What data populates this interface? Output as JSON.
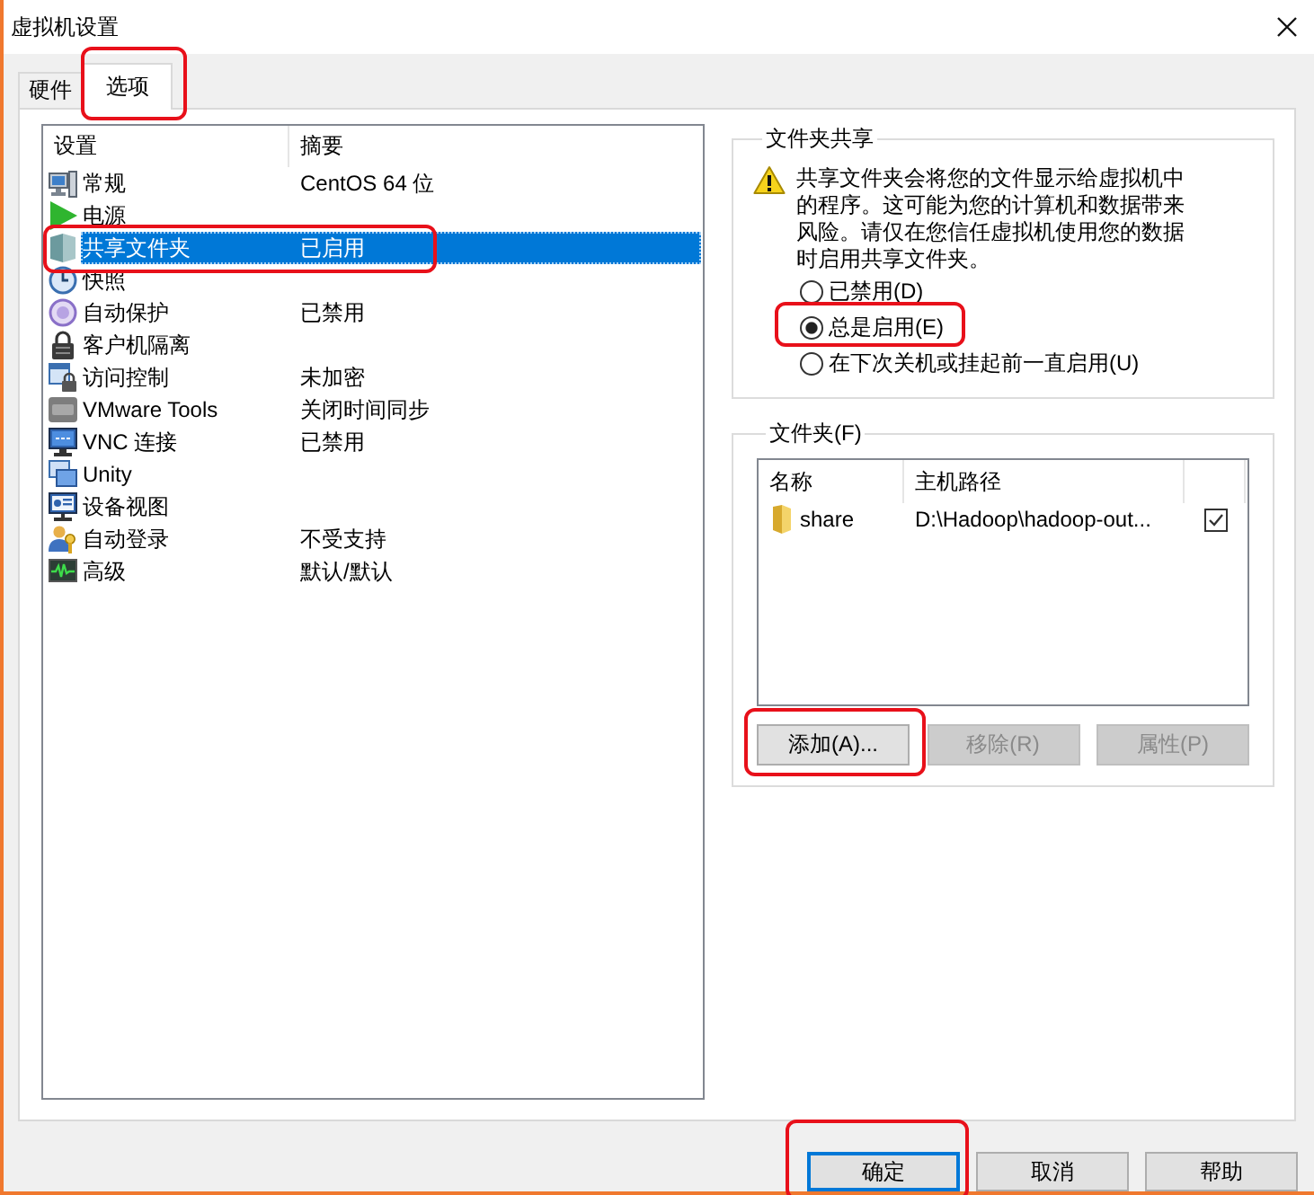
{
  "window": {
    "title": "虚拟机设置"
  },
  "tabs": [
    {
      "label": "硬件",
      "selected": false,
      "highlighted": false
    },
    {
      "label": "选项",
      "selected": true,
      "highlighted": true
    }
  ],
  "settings": {
    "columns": [
      "设置",
      "摘要"
    ],
    "rows": [
      {
        "name": "常规",
        "summary": "CentOS 64 位",
        "selected": false,
        "highlighted": false
      },
      {
        "name": "电源",
        "selected": false,
        "highlighted": false
      },
      {
        "name": "共享文件夹",
        "summary": "已启用",
        "selected": true,
        "highlighted": true
      },
      {
        "name": "快照",
        "selected": false,
        "highlighted": false
      },
      {
        "name": "自动保护",
        "summary": "已禁用",
        "selected": false,
        "highlighted": false
      },
      {
        "name": "客户机隔离",
        "selected": false,
        "highlighted": false
      },
      {
        "name": "访问控制",
        "summary": "未加密",
        "selected": false,
        "highlighted": false
      },
      {
        "name": "VMware Tools",
        "summary": "关闭时间同步",
        "selected": false,
        "highlighted": false
      },
      {
        "name": "VNC 连接",
        "summary": "已禁用",
        "selected": false,
        "highlighted": false
      },
      {
        "name": "Unity",
        "selected": false,
        "highlighted": false
      },
      {
        "name": "设备视图",
        "selected": false,
        "highlighted": false
      },
      {
        "name": "自动登录",
        "summary": "不受支持",
        "selected": false,
        "highlighted": false
      },
      {
        "name": "高级",
        "summary": "默认/默认",
        "selected": false,
        "highlighted": false
      }
    ]
  },
  "folder_sharing": {
    "title": "文件夹共享",
    "warning": "共享文件夹会将您的文件显示给虚拟机中的程序。这可能为您的计算机和数据带来风险。请仅在您信任虚拟机使用您的数据时启用共享文件夹。",
    "options": [
      {
        "label": "已禁用(D)",
        "selected": false,
        "highlighted": false
      },
      {
        "label": "总是启用(E)",
        "selected": true,
        "highlighted": true
      },
      {
        "label": "在下次关机或挂起前一直启用(U)",
        "selected": false,
        "highlighted": false
      }
    ]
  },
  "folders": {
    "title": "文件夹(F)",
    "columns": [
      "名称",
      "主机路径"
    ],
    "rows": [
      {
        "name": "share",
        "path": "D:\\Hadoop\\hadoop-out...",
        "checked": true
      }
    ],
    "buttons": [
      {
        "label": "添加(A)...",
        "disabled": false,
        "highlighted": true
      },
      {
        "label": "移除(R)",
        "disabled": true,
        "highlighted": false
      },
      {
        "label": "属性(P)",
        "disabled": true,
        "highlighted": false
      }
    ]
  },
  "dialog_buttons": [
    {
      "label": "确定",
      "default": true,
      "highlighted": true
    },
    {
      "label": "取消",
      "default": false,
      "highlighted": false
    },
    {
      "label": "帮助",
      "default": false,
      "highlighted": false
    }
  ]
}
